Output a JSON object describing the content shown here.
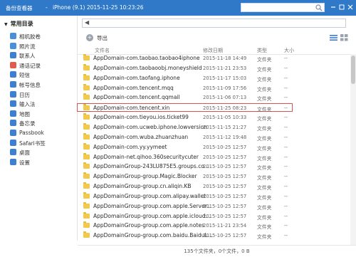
{
  "titlebar": {
    "app_title": "备份查看器",
    "separator": "-",
    "device": "iPhone (9.1)  2015-11-25 10:23:26",
    "controls": [
      "minimize-icon",
      "maximize-icon",
      "close-icon"
    ]
  },
  "sidebar": {
    "header": "常用目录",
    "items": [
      {
        "label": "相机胶卷",
        "icon": "camera-roll-icon",
        "color": "#4a90d9"
      },
      {
        "label": "照片流",
        "icon": "photo-stream-icon",
        "color": "#4a90d9"
      },
      {
        "label": "联系人",
        "icon": "contacts-icon",
        "color": "#3d7fd1"
      },
      {
        "label": "通话记录",
        "icon": "call-log-icon",
        "color": "#e05b4b"
      },
      {
        "label": "短信",
        "icon": "sms-icon",
        "color": "#3d7fd1"
      },
      {
        "label": "帐号信息",
        "icon": "account-icon",
        "color": "#3d7fd1"
      },
      {
        "label": "日历",
        "icon": "calendar-icon",
        "color": "#3d7fd1"
      },
      {
        "label": "输入法",
        "icon": "keyboard-icon",
        "color": "#3d7fd1"
      },
      {
        "label": "地图",
        "icon": "map-icon",
        "color": "#3d7fd1"
      },
      {
        "label": "备忘录",
        "icon": "notes-icon",
        "color": "#3d7fd1"
      },
      {
        "label": "Passbook",
        "icon": "passbook-icon",
        "color": "#3d7fd1"
      },
      {
        "label": "Safari书签",
        "icon": "safari-icon",
        "color": "#3d7fd1"
      },
      {
        "label": "桌面",
        "icon": "desktop-icon",
        "color": "#3d7fd1"
      },
      {
        "label": "设置",
        "icon": "settings-icon",
        "color": "#3d7fd1"
      }
    ]
  },
  "toolbar": {
    "export_label": "导出"
  },
  "columns": {
    "name": "文件名",
    "date": "修改日期",
    "type": "类型",
    "size": "大小"
  },
  "files": [
    {
      "name": "AppDomain-com.taobao.taobao4iphone",
      "date": "2015-11-18 14:49",
      "type": "文件夹",
      "size": "--"
    },
    {
      "name": "AppDomain-com.taobaoobj.moneyshield",
      "date": "2015-11-21 23:53",
      "type": "文件夹",
      "size": "--"
    },
    {
      "name": "AppDomain-com.taofang.iphone",
      "date": "2015-11-17 15:03",
      "type": "文件夹",
      "size": "--"
    },
    {
      "name": "AppDomain-com.tencent.mqq",
      "date": "2015-11-09 17:56",
      "type": "文件夹",
      "size": "--"
    },
    {
      "name": "AppDomain-com.tencent.qqmail",
      "date": "2015-11-06 07:13",
      "type": "文件夹",
      "size": "--"
    },
    {
      "name": "AppDomain-com.tencent.xin",
      "date": "2015-11-25 08:23",
      "type": "文件夹",
      "size": "--",
      "highlighted": true
    },
    {
      "name": "AppDomain-com.tieyou.ios.ticket99",
      "date": "2015-11-05 10:33",
      "type": "文件夹",
      "size": "--"
    },
    {
      "name": "AppDomain-com.ucweb.iphone.lowversion",
      "date": "2015-11-15 21:27",
      "type": "文件夹",
      "size": "--"
    },
    {
      "name": "AppDomain-com.wuba.zhuanzhuan",
      "date": "2015-11-12 19:48",
      "type": "文件夹",
      "size": "--"
    },
    {
      "name": "AppDomain-com.yy.yymeet",
      "date": "2015-10-25 12:57",
      "type": "文件夹",
      "size": "--"
    },
    {
      "name": "AppDomain-net.qihoo.360securitycuter",
      "date": "2015-10-25 12:57",
      "type": "文件夹",
      "size": "--"
    },
    {
      "name": "AppDomainGroup-243LU875E5.groups.co...",
      "date": "2015-10-25 12:57",
      "type": "文件夹",
      "size": "--"
    },
    {
      "name": "AppDomainGroup-group.Magic.Blocker",
      "date": "2015-10-25 12:57",
      "type": "文件夹",
      "size": "--"
    },
    {
      "name": "AppDomainGroup-group.cn.aliqin.KB",
      "date": "2015-10-25 12:57",
      "type": "文件夹",
      "size": "--"
    },
    {
      "name": "AppDomainGroup-group.com.alipay.wallet",
      "date": "2015-10-25 12:57",
      "type": "文件夹",
      "size": "--"
    },
    {
      "name": "AppDomainGroup-group.com.apple.Server...",
      "date": "2015-10-25 12:57",
      "type": "文件夹",
      "size": "--"
    },
    {
      "name": "AppDomainGroup-group.com.apple.icloud...",
      "date": "2015-10-25 12:57",
      "type": "文件夹",
      "size": "--"
    },
    {
      "name": "AppDomainGroup-group.com.apple.notes",
      "date": "2015-11-21 23:54",
      "type": "文件夹",
      "size": "--"
    },
    {
      "name": "AppDomainGroup-group.com.baidu.BaiduL...",
      "date": "2015-10-25 12:57",
      "type": "文件夹",
      "size": "--"
    }
  ],
  "status": "135个文件夹，0个文件，0 B"
}
